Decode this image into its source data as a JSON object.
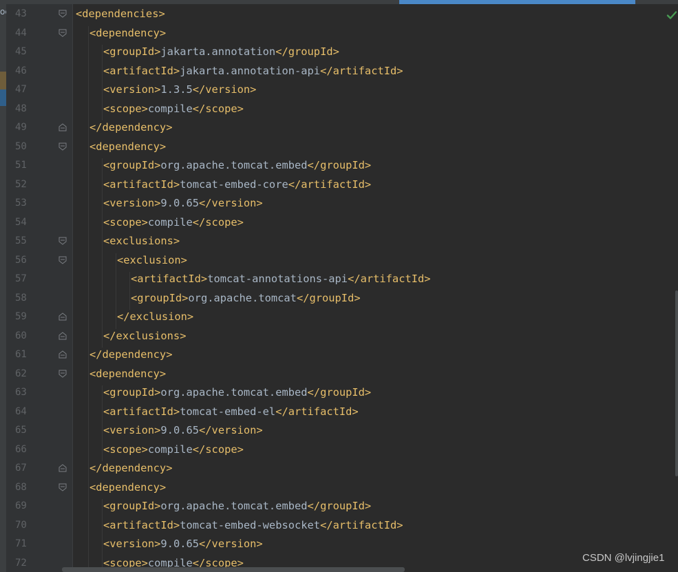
{
  "editor": {
    "left_stub": "oc",
    "lines": [
      {
        "n": "43",
        "indent": 0,
        "parts": [
          [
            "tag",
            "<dependencies>"
          ]
        ],
        "fold": "open"
      },
      {
        "n": "44",
        "indent": 1,
        "parts": [
          [
            "tag",
            "<dependency>"
          ]
        ],
        "fold": "open"
      },
      {
        "n": "45",
        "indent": 2,
        "parts": [
          [
            "tag",
            "<groupId>"
          ],
          [
            "txt",
            "jakarta.annotation"
          ],
          [
            "tag",
            "</groupId>"
          ]
        ],
        "fold": ""
      },
      {
        "n": "46",
        "indent": 2,
        "parts": [
          [
            "tag",
            "<artifactId>"
          ],
          [
            "txt",
            "jakarta.annotation-api"
          ],
          [
            "tag",
            "</artifactId>"
          ]
        ],
        "fold": ""
      },
      {
        "n": "47",
        "indent": 2,
        "parts": [
          [
            "tag",
            "<version>"
          ],
          [
            "txt",
            "1.3.5"
          ],
          [
            "tag",
            "</version>"
          ]
        ],
        "fold": ""
      },
      {
        "n": "48",
        "indent": 2,
        "parts": [
          [
            "tag",
            "<scope>"
          ],
          [
            "txt",
            "compile"
          ],
          [
            "tag",
            "</scope>"
          ]
        ],
        "fold": ""
      },
      {
        "n": "49",
        "indent": 1,
        "parts": [
          [
            "tag",
            "</dependency>"
          ]
        ],
        "fold": "close"
      },
      {
        "n": "50",
        "indent": 1,
        "parts": [
          [
            "tag",
            "<dependency>"
          ]
        ],
        "fold": "open"
      },
      {
        "n": "51",
        "indent": 2,
        "parts": [
          [
            "tag",
            "<groupId>"
          ],
          [
            "txt",
            "org.apache.tomcat.embed"
          ],
          [
            "tag",
            "</groupId>"
          ]
        ],
        "fold": ""
      },
      {
        "n": "52",
        "indent": 2,
        "parts": [
          [
            "tag",
            "<artifactId>"
          ],
          [
            "txt",
            "tomcat-embed-core"
          ],
          [
            "tag",
            "</artifactId>"
          ]
        ],
        "fold": ""
      },
      {
        "n": "53",
        "indent": 2,
        "parts": [
          [
            "tag",
            "<version>"
          ],
          [
            "txt",
            "9.0.65"
          ],
          [
            "tag",
            "</version>"
          ]
        ],
        "fold": ""
      },
      {
        "n": "54",
        "indent": 2,
        "parts": [
          [
            "tag",
            "<scope>"
          ],
          [
            "txt",
            "compile"
          ],
          [
            "tag",
            "</scope>"
          ]
        ],
        "fold": ""
      },
      {
        "n": "55",
        "indent": 2,
        "parts": [
          [
            "tag",
            "<exclusions>"
          ]
        ],
        "fold": "open"
      },
      {
        "n": "56",
        "indent": 3,
        "parts": [
          [
            "tag",
            "<exclusion>"
          ]
        ],
        "fold": "open"
      },
      {
        "n": "57",
        "indent": 4,
        "parts": [
          [
            "tag",
            "<artifactId>"
          ],
          [
            "txt",
            "tomcat-annotations-api"
          ],
          [
            "tag",
            "</artifactId>"
          ]
        ],
        "fold": ""
      },
      {
        "n": "58",
        "indent": 4,
        "parts": [
          [
            "tag",
            "<groupId>"
          ],
          [
            "txt",
            "org.apache.tomcat"
          ],
          [
            "tag",
            "</groupId>"
          ]
        ],
        "fold": ""
      },
      {
        "n": "59",
        "indent": 3,
        "parts": [
          [
            "tag",
            "</exclusion>"
          ]
        ],
        "fold": "close"
      },
      {
        "n": "60",
        "indent": 2,
        "parts": [
          [
            "tag",
            "</exclusions>"
          ]
        ],
        "fold": "close"
      },
      {
        "n": "61",
        "indent": 1,
        "parts": [
          [
            "tag",
            "</dependency>"
          ]
        ],
        "fold": "close"
      },
      {
        "n": "62",
        "indent": 1,
        "parts": [
          [
            "tag",
            "<dependency>"
          ]
        ],
        "fold": "open"
      },
      {
        "n": "63",
        "indent": 2,
        "parts": [
          [
            "tag",
            "<groupId>"
          ],
          [
            "txt",
            "org.apache.tomcat.embed"
          ],
          [
            "tag",
            "</groupId>"
          ]
        ],
        "fold": ""
      },
      {
        "n": "64",
        "indent": 2,
        "parts": [
          [
            "tag",
            "<artifactId>"
          ],
          [
            "txt",
            "tomcat-embed-el"
          ],
          [
            "tag",
            "</artifactId>"
          ]
        ],
        "fold": ""
      },
      {
        "n": "65",
        "indent": 2,
        "parts": [
          [
            "tag",
            "<version>"
          ],
          [
            "txt",
            "9.0.65"
          ],
          [
            "tag",
            "</version>"
          ]
        ],
        "fold": ""
      },
      {
        "n": "66",
        "indent": 2,
        "parts": [
          [
            "tag",
            "<scope>"
          ],
          [
            "txt",
            "compile"
          ],
          [
            "tag",
            "</scope>"
          ]
        ],
        "fold": ""
      },
      {
        "n": "67",
        "indent": 1,
        "parts": [
          [
            "tag",
            "</dependency>"
          ]
        ],
        "fold": "close"
      },
      {
        "n": "68",
        "indent": 1,
        "parts": [
          [
            "tag",
            "<dependency>"
          ]
        ],
        "fold": "open"
      },
      {
        "n": "69",
        "indent": 2,
        "parts": [
          [
            "tag",
            "<groupId>"
          ],
          [
            "txt",
            "org.apache.tomcat.embed"
          ],
          [
            "tag",
            "</groupId>"
          ]
        ],
        "fold": ""
      },
      {
        "n": "70",
        "indent": 2,
        "parts": [
          [
            "tag",
            "<artifactId>"
          ],
          [
            "txt",
            "tomcat-embed-websocket"
          ],
          [
            "tag",
            "</artifactId>"
          ]
        ],
        "fold": ""
      },
      {
        "n": "71",
        "indent": 2,
        "parts": [
          [
            "tag",
            "<version>"
          ],
          [
            "txt",
            "9.0.65"
          ],
          [
            "tag",
            "</version>"
          ]
        ],
        "fold": ""
      },
      {
        "n": "72",
        "indent": 2,
        "parts": [
          [
            "tag",
            "<scope>"
          ],
          [
            "txt",
            "compile"
          ],
          [
            "tag",
            "</scope>"
          ]
        ],
        "fold": ""
      }
    ]
  },
  "status": {
    "inspection_icon": "check-icon",
    "inspection_color": "#499c54"
  },
  "watermark": "CSDN @lvjingjie1",
  "colors": {
    "tag": "#e8bf6a",
    "text": "#a9b7c6",
    "background": "#2b2b2b",
    "gutter": "#313335",
    "line_number": "#606366"
  }
}
